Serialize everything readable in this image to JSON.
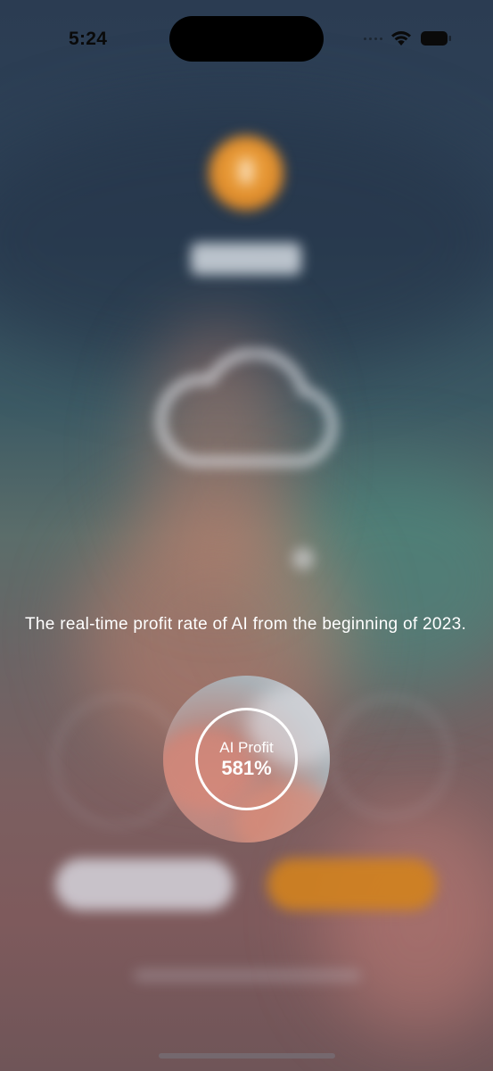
{
  "status_bar": {
    "time": "5:24",
    "icons": [
      "signal-icon",
      "wifi-icon",
      "battery-icon"
    ]
  },
  "guide": {
    "description": "The real-time profit rate of AI from the beginning of 2023.",
    "highlight": {
      "label": "AI Profit",
      "value": "581%"
    }
  },
  "colors": {
    "accent_orange": "#dd8b2b",
    "overlay_text": "#ffffff"
  }
}
